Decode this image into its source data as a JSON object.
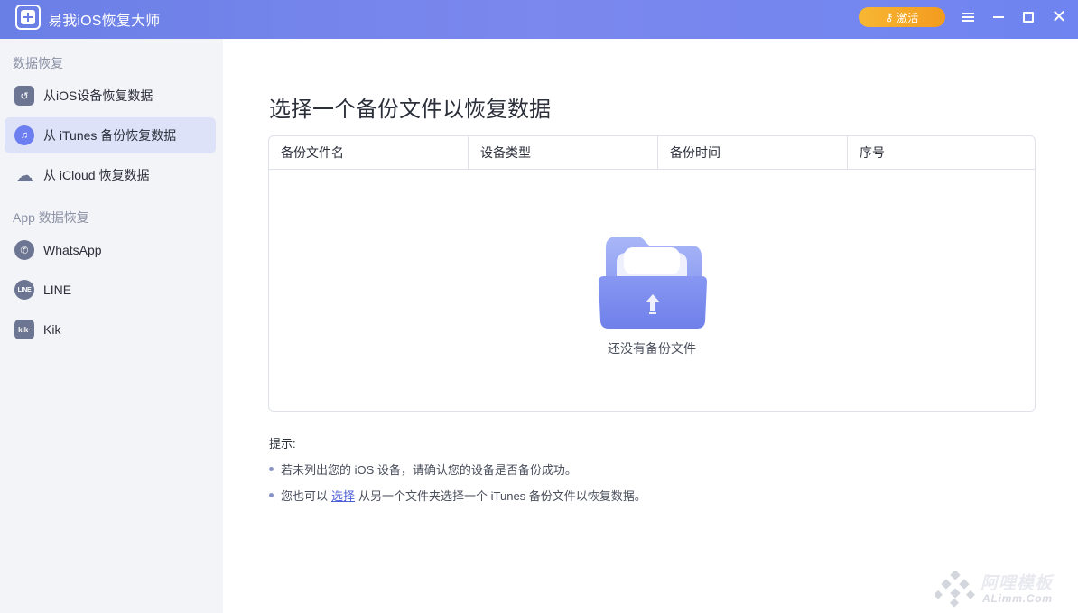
{
  "app": {
    "title": "易我iOS恢复大师",
    "activate_label": "激活"
  },
  "sidebar": {
    "section_data_recovery": "数据恢复",
    "section_app_recovery": "App 数据恢复",
    "items": [
      {
        "label": "从iOS设备恢复数据",
        "icon": "phone-restore-icon"
      },
      {
        "label": "从 iTunes 备份恢复数据",
        "icon": "music-note-icon",
        "active": true
      },
      {
        "label": "从 iCloud 恢复数据",
        "icon": "cloud-restore-icon"
      },
      {
        "label": "WhatsApp",
        "icon": "whatsapp-icon"
      },
      {
        "label": "LINE",
        "icon": "line-icon",
        "icon_text": "LINE"
      },
      {
        "label": "Kik",
        "icon": "kik-icon",
        "icon_text": "kik·"
      }
    ]
  },
  "main": {
    "title": "选择一个备份文件以恢复数据",
    "columns": [
      "备份文件名",
      "设备类型",
      "备份时间",
      "序号"
    ],
    "empty_text": "还没有备份文件",
    "tips_title": "提示:",
    "tip1": "若未列出您的 iOS 设备，请确认您的设备是否备份成功。",
    "tip2_before": "您也可以",
    "tip2_link": "选择",
    "tip2_after": "从另一个文件夹选择一个 iTunes 备份文件以恢复数据。"
  },
  "watermark": {
    "text": "阿哩模板",
    "sub": "ALimm.Com"
  },
  "colors": {
    "accent": "#6a7fe6",
    "activate": "#f5a623",
    "sidebar_bg": "#f3f4f8",
    "active_item": "#dde2f8"
  }
}
